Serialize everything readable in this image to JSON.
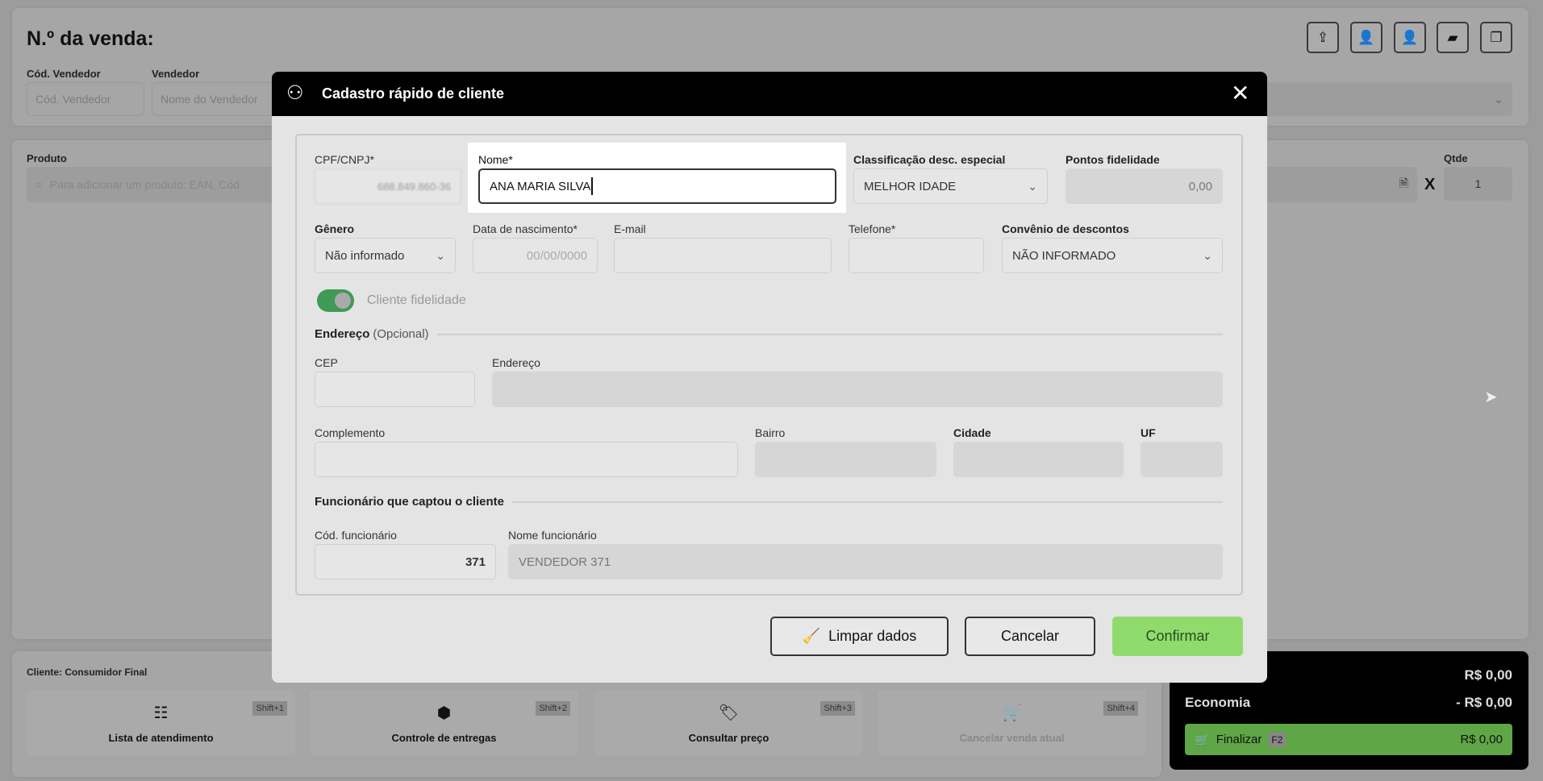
{
  "header": {
    "title": "N.º da venda:",
    "seller_code_label": "Cód. Vendedor",
    "seller_code_placeholder": "Cód. Vendedor",
    "seller_label": "Vendedor",
    "seller_placeholder": "Nome do Vendedor"
  },
  "product": {
    "label": "Produto",
    "placeholder": "Para adicionar um produto: EAN, Cód",
    "qty_label": "Qtde",
    "qty_value": "1",
    "times": "X"
  },
  "bottom": {
    "client": "Cliente: Consumidor Final",
    "actions": [
      {
        "label": "Lista de atendimento",
        "shortcut": "Shift+1"
      },
      {
        "label": "Controle de entregas",
        "shortcut": "Shift+2"
      },
      {
        "label": "Consultar preço",
        "shortcut": "Shift+3"
      },
      {
        "label": "Cancelar venda atual",
        "shortcut": "Shift+4"
      }
    ]
  },
  "totals": {
    "total": "R$ 0,00",
    "economy_label": "Economia",
    "economy": "- R$ 0,00",
    "finalize_label": "Finalizar",
    "finalize_key": "F2",
    "finalize_value": "R$ 0,00"
  },
  "modal": {
    "title": "Cadastro rápido de cliente",
    "cpf_label": "CPF/CNPJ*",
    "cpf_value": "688.849.860-36",
    "name_label": "Nome*",
    "name_value": "ANA MARIA SILVA",
    "class_label": "Classificação desc. especial",
    "class_value": "MELHOR IDADE",
    "points_label": "Pontos fidelidade",
    "points_value": "0,00",
    "gender_label": "Gênero",
    "gender_value": "Não informado",
    "birth_label": "Data de nascimento*",
    "birth_placeholder": "00/00/0000",
    "email_label": "E-mail",
    "phone_label": "Telefone*",
    "agreement_label": "Convênio de descontos",
    "agreement_value": "NÃO INFORMADO",
    "loyalty_label": "Cliente fidelidade",
    "address_section": "Endereço",
    "address_optional": "(Opcional)",
    "cep_label": "CEP",
    "address_label": "Endereço",
    "complement_label": "Complemento",
    "district_label": "Bairro",
    "city_label": "Cidade",
    "uf_label": "UF",
    "employee_section": "Funcionário que captou o cliente",
    "emp_code_label": "Cód. funcionário",
    "emp_code_value": "371",
    "emp_name_label": "Nome funcionário",
    "emp_name_value": "VENDEDOR 371",
    "clear_label": "Limpar dados",
    "cancel_label": "Cancelar",
    "confirm_label": "Confirmar"
  },
  "colors": {
    "confirm": "#8fdc6c",
    "finalize": "#5fa646"
  }
}
